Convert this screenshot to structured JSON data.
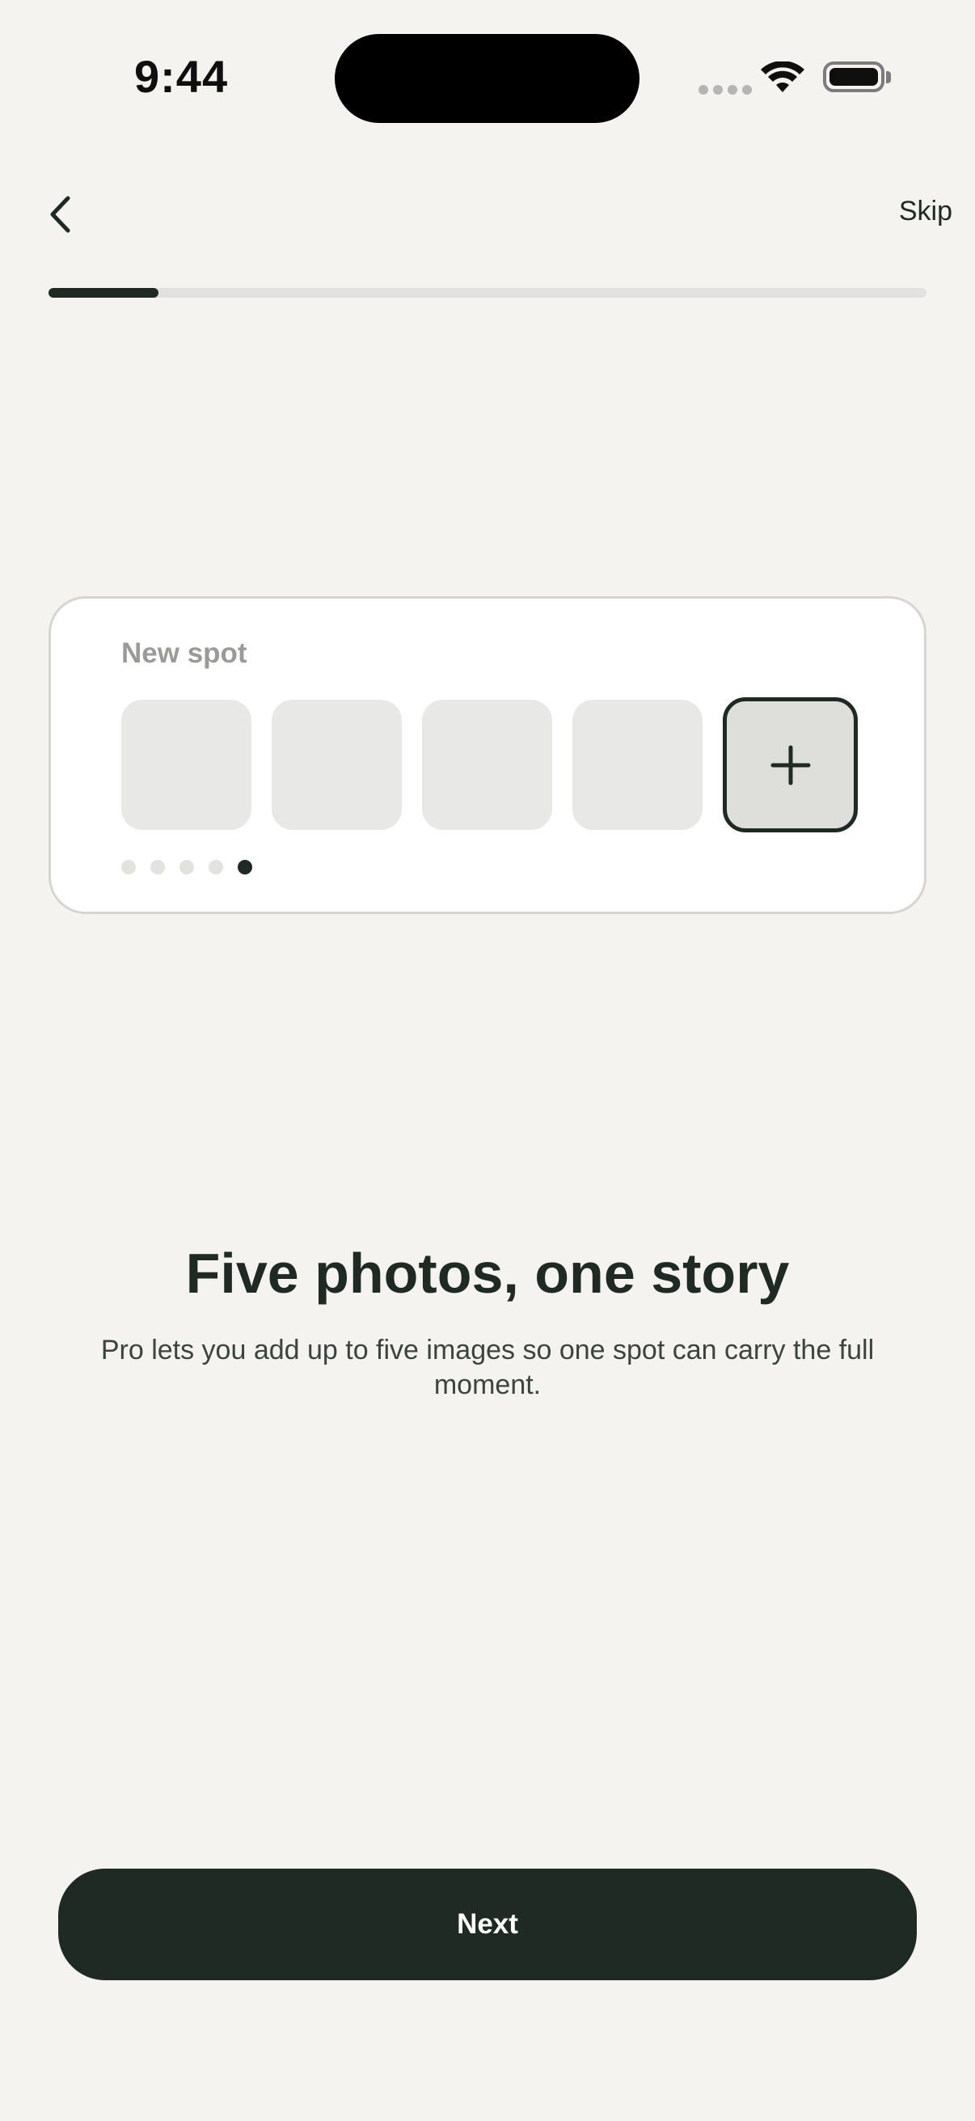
{
  "status_bar": {
    "time": "9:44"
  },
  "nav": {
    "back_icon": "chevron-left-icon",
    "skip_label": "Skip"
  },
  "progress": {
    "fraction": 0.125
  },
  "card": {
    "title": "New spot",
    "photo_slot_count": 4,
    "add_icon": "plus-icon",
    "pager": {
      "count": 5,
      "active_index": 4
    }
  },
  "content": {
    "headline": "Five photos, one story",
    "body": "Pro lets you add up to five images so one spot can carry the full moment."
  },
  "cta": {
    "next_label": "Next"
  },
  "colors": {
    "background": "#f4f3f0",
    "primary": "#1f2a24",
    "card": "#ffffff",
    "slot": "#e8e8e6",
    "muted_text": "#9a9a97"
  }
}
